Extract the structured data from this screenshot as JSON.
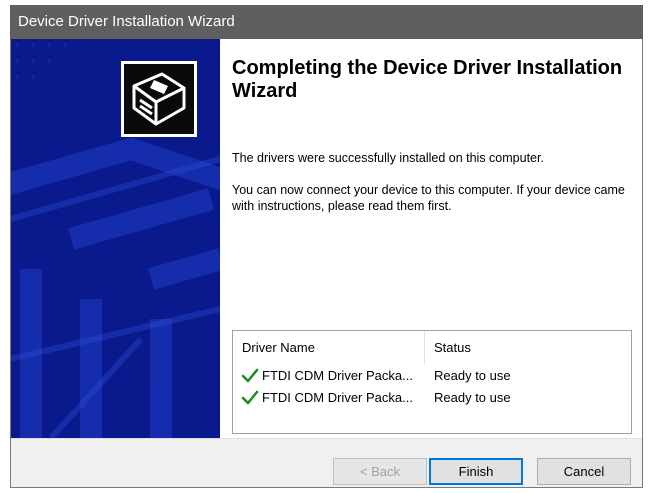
{
  "window": {
    "title": "Device Driver Installation Wizard"
  },
  "colors": {
    "title_bar": "#5f5f5f",
    "side_panel": "#0a1a8c",
    "side_panel_pattern": "#1e3cc8",
    "check": "#1a8c1a",
    "default_button_border": "#0078d7"
  },
  "main": {
    "heading": "Completing the Device Driver Installation Wizard",
    "success_message": "The drivers were successfully installed on this computer.",
    "instructions": "You can now connect your device to this computer. If your device came with instructions, please read them first."
  },
  "driver_table": {
    "columns": [
      "Driver Name",
      "Status"
    ],
    "rows": [
      {
        "icon": "green-check-icon",
        "name": "FTDI CDM Driver Packa...",
        "status": "Ready to use"
      },
      {
        "icon": "green-check-icon",
        "name": "FTDI CDM Driver Packa...",
        "status": "Ready to use"
      }
    ]
  },
  "buttons": {
    "back": "< Back",
    "finish": "Finish",
    "cancel": "Cancel"
  },
  "icons": {
    "wizard": "hardware-install-icon"
  }
}
